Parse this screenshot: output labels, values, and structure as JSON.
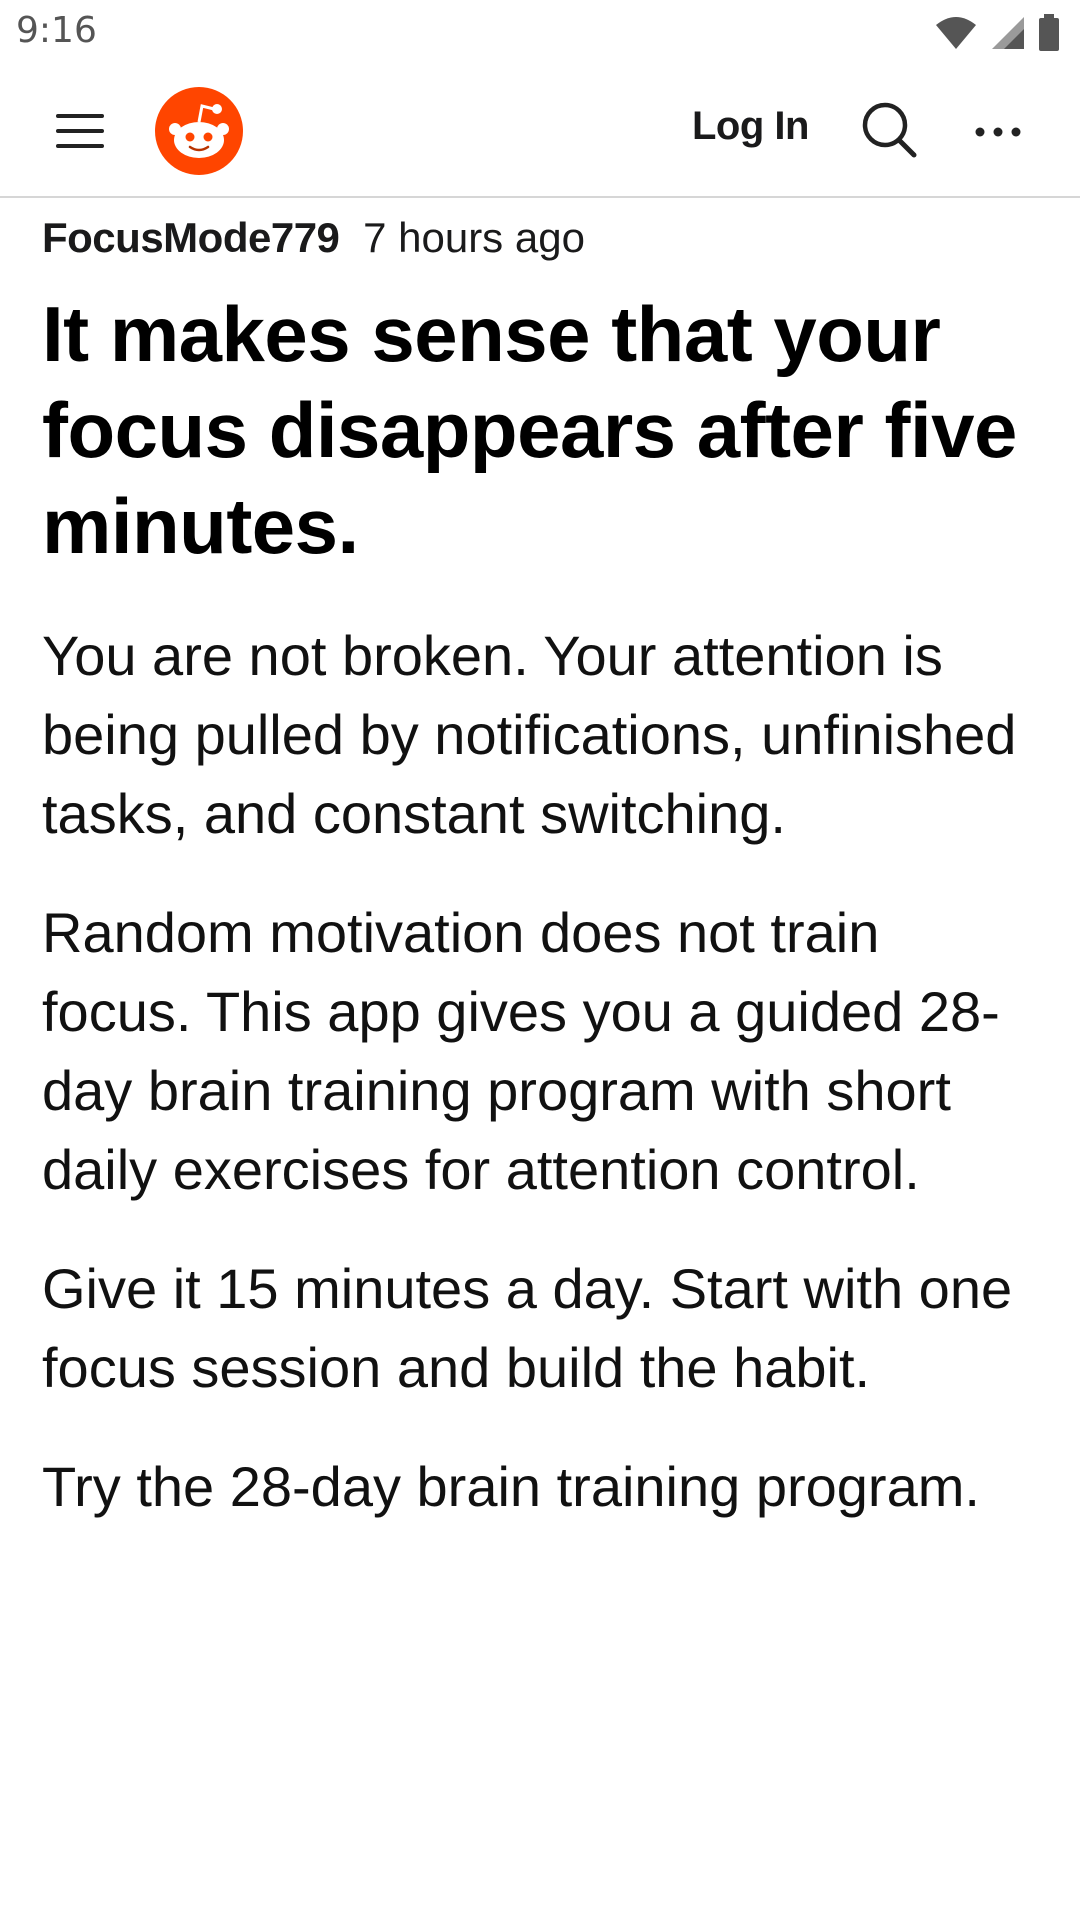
{
  "status_bar": {
    "time": "9:16",
    "icons": [
      "wifi-icon",
      "signal-icon",
      "battery-icon"
    ]
  },
  "header": {
    "logo_icon": "reddit-logo-icon",
    "login_label": "Log In",
    "icons": [
      "menu-icon",
      "search-icon",
      "more-icon"
    ],
    "brand_color": "#ff4500"
  },
  "post": {
    "author": "FocusMode779",
    "time": "7 hours ago",
    "title": "It makes sense that your focus disappears after five minutes.",
    "paragraphs": [
      "You are not broken. Your attention is being pulled by notifications, unfinished tasks, and constant switching.",
      "Random motivation does not train focus. This app gives you a guided 28-day brain training program with short daily exercises for attention control.",
      "Give it 15 minutes a day. Start with one focus session and build the habit.",
      "Try the 28-day brain training program."
    ]
  }
}
